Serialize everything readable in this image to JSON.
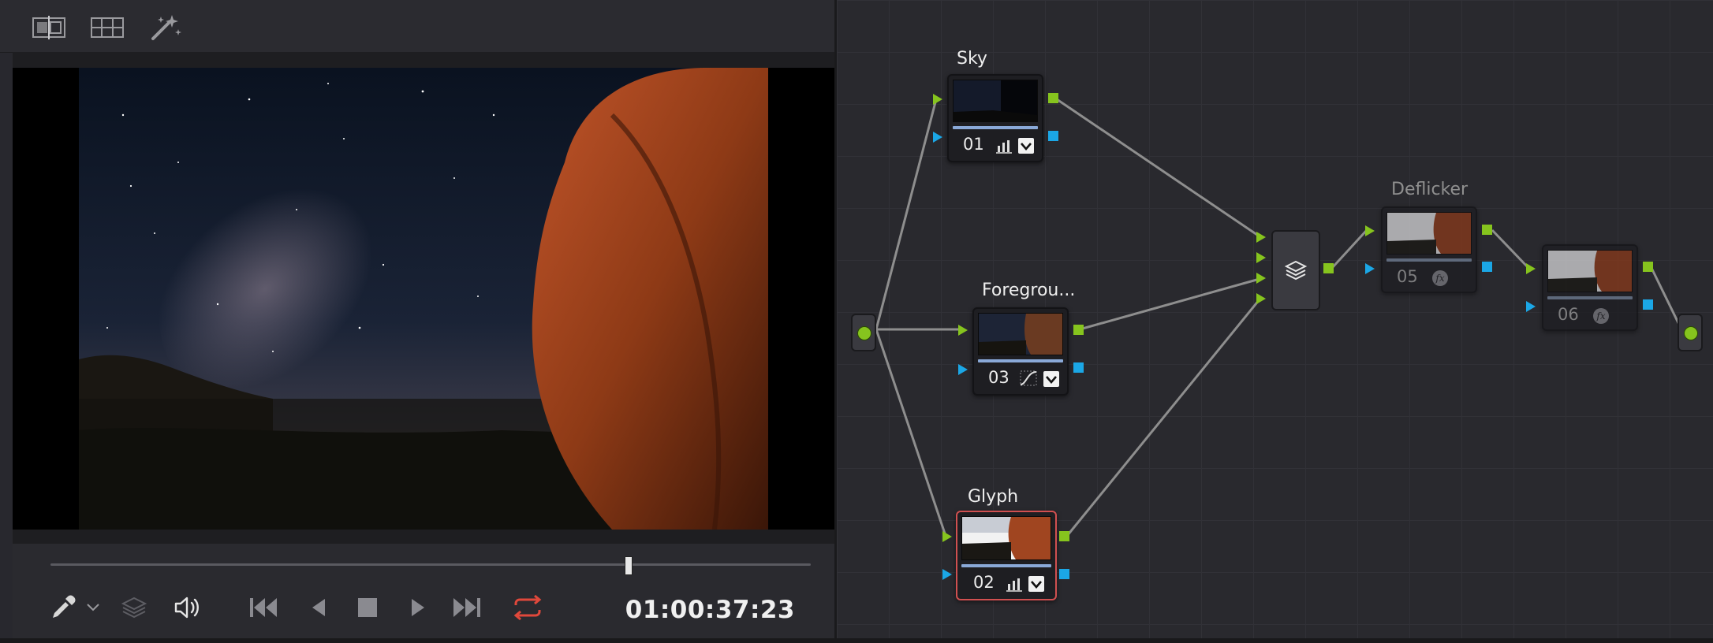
{
  "toolbar": {
    "icons": [
      "compare-split-icon",
      "grid-view-icon",
      "magic-wand-icon"
    ]
  },
  "transport": {
    "timecode": "01:00:37:23",
    "playhead_position": 0.76,
    "icons": [
      "eyedropper-icon",
      "chevron-down-icon",
      "layers-icon",
      "volume-icon",
      "skip-to-start-icon",
      "step-back-icon",
      "stop-icon",
      "play-icon",
      "skip-to-end-icon",
      "loop-icon"
    ],
    "loop_color": "#e0483b"
  },
  "node_graph": {
    "nodes": [
      {
        "id": "01",
        "label": "Sky",
        "tools": [
          "bars-icon",
          "check-icon"
        ],
        "selected": false
      },
      {
        "id": "03",
        "label": "Foregrou...",
        "tools": [
          "curve-icon",
          "check-icon"
        ],
        "selected": false
      },
      {
        "id": "02",
        "label": "Glyph",
        "tools": [
          "bars-icon",
          "check-icon"
        ],
        "selected": true
      },
      {
        "id": "05",
        "label": "Deflicker",
        "tools": [
          "fx-icon"
        ],
        "selected": false
      },
      {
        "id": "06",
        "label": "",
        "tools": [
          "fx-icon"
        ],
        "selected": false
      }
    ],
    "layer_mixer_icon": "stack-icon",
    "colors": {
      "rgb_input": "#86c41e",
      "alpha_input": "#1ba7e6",
      "selected_border": "#d05050",
      "link": "#8e8e8e"
    }
  }
}
